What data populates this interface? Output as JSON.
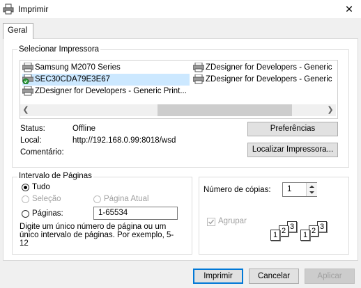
{
  "window": {
    "title": "Imprimir",
    "close_glyph": "✕"
  },
  "tabs": [
    {
      "label": "Geral"
    }
  ],
  "select_printer": {
    "label": "Selecionar Impressora",
    "printers": [
      {
        "name": "Samsung M2070 Series",
        "icon": "printer-icon"
      },
      {
        "name": "SEC30CDA79E3E67",
        "icon": "network-printer-icon",
        "selected": true
      },
      {
        "name": "ZDesigner for Developers - Generic Print...",
        "icon": "printer-icon"
      },
      {
        "name": "ZDesigner for Developers - Generic",
        "icon": "printer-icon"
      },
      {
        "name": "ZDesigner for Developers - Generic",
        "icon": "printer-icon"
      }
    ],
    "status_label": "Status:",
    "status_value": "Offline",
    "location_label": "Local:",
    "location_value": "http://192.168.0.99:8018/wsd",
    "comment_label": "Comentário:",
    "comment_value": "",
    "preferences_button": "Preferências",
    "find_printer_button": "Localizar Impressora..."
  },
  "page_range": {
    "label": "Intervalo de Páginas",
    "all": "Tudo",
    "selection": "Seleção",
    "current_page": "Página Atual",
    "pages": "Páginas:",
    "pages_value": "1-65534",
    "hint": "Digite um único número de página ou um único intervalo de páginas. Por exemplo, 5-12"
  },
  "copies": {
    "label": "Número de cópias:",
    "value": "1",
    "collate": "Agrupar",
    "collate_checked": true,
    "pages_glyphs": [
      "1",
      "2",
      "3"
    ]
  },
  "footer": {
    "print_button": "Imprimir",
    "cancel_button": "Cancelar",
    "apply_button": "Aplicar"
  }
}
